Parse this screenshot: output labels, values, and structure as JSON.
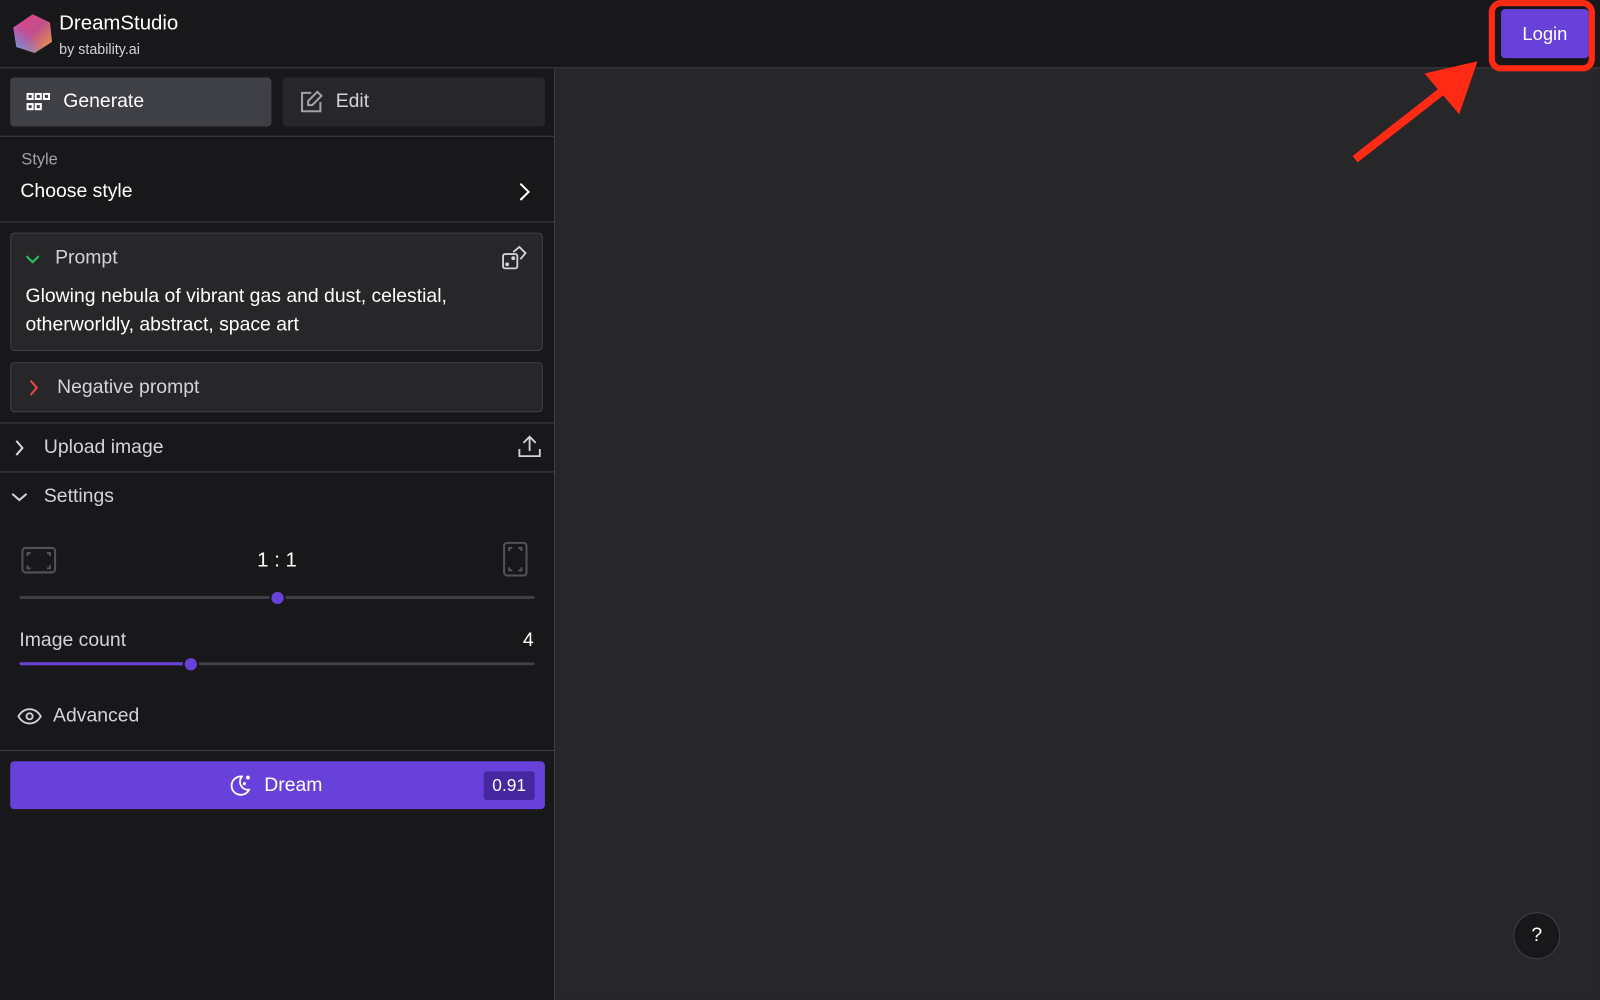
{
  "header": {
    "title": "DreamStudio",
    "subtitle": "by stability.ai",
    "login_label": "Login"
  },
  "tabs": [
    {
      "label": "Generate",
      "active": true
    },
    {
      "label": "Edit",
      "active": false
    }
  ],
  "style": {
    "label": "Style",
    "value": "Choose style"
  },
  "prompt": {
    "label": "Prompt",
    "text": "Glowing nebula of vibrant gas and dust, celestial, otherworldly, abstract, space art"
  },
  "negative_prompt": {
    "label": "Negative prompt"
  },
  "upload": {
    "label": "Upload image"
  },
  "settings": {
    "label": "Settings",
    "aspect_ratio": "1 : 1",
    "aspect_slider_percent": 50,
    "image_count_label": "Image count",
    "image_count": "4",
    "image_count_min": 1,
    "image_count_max": 10,
    "advanced_label": "Advanced"
  },
  "dream": {
    "label": "Dream",
    "cost": "0.91"
  },
  "help_label": "?",
  "colors": {
    "accent": "#6741d9",
    "annotation": "#ff2a14",
    "background": "#27272a",
    "sidebar": "#18181b"
  }
}
